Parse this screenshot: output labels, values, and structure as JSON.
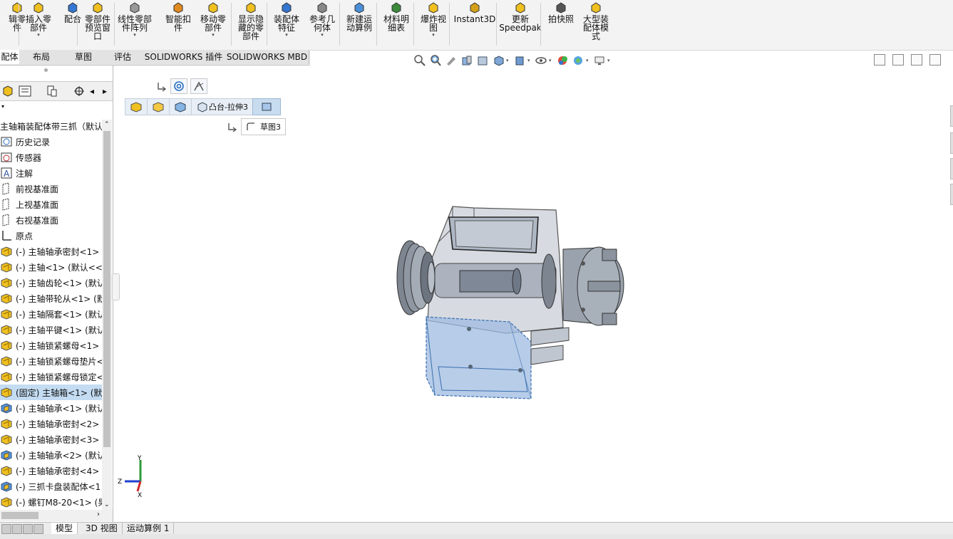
{
  "ribbon": {
    "buttons": [
      {
        "id": "edit-component",
        "label": "辑零\n件",
        "dd": false
      },
      {
        "id": "insert-components",
        "label": "插入零\n部件",
        "dd": true
      },
      {
        "id": "mate",
        "label": "配合",
        "dd": false
      },
      {
        "id": "component-preview",
        "label": "零部件\n预览窗\n口",
        "dd": false
      },
      {
        "id": "linear-pattern",
        "label": "线性零部\n件阵列",
        "dd": true
      },
      {
        "id": "smart-fasteners",
        "label": "智能扣\n件",
        "dd": false
      },
      {
        "id": "move-component",
        "label": "移动零\n部件",
        "dd": true
      },
      {
        "id": "show-hidden",
        "label": "显示隐\n藏的零\n部件",
        "dd": false
      },
      {
        "id": "assembly-features",
        "label": "装配体\n特征",
        "dd": true
      },
      {
        "id": "reference-geometry",
        "label": "参考几\n何体",
        "dd": true
      },
      {
        "id": "new-motion-study",
        "label": "新建运\n动算例",
        "dd": false
      },
      {
        "id": "bom",
        "label": "材料明\n细表",
        "dd": false
      },
      {
        "id": "exploded-view",
        "label": "爆炸视\n图",
        "dd": true
      },
      {
        "id": "instant3d",
        "label": "Instant3D",
        "dd": false
      },
      {
        "id": "update-speedpak",
        "label": "更新\nSpeedpak",
        "dd": false
      },
      {
        "id": "snapshot",
        "label": "拍快照",
        "dd": false
      },
      {
        "id": "large-assembly",
        "label": "大型装\n配体模\n式",
        "dd": false
      }
    ]
  },
  "tabs": [
    {
      "label": "配体",
      "active": true
    },
    {
      "label": "布局",
      "active": false
    },
    {
      "label": "草图",
      "active": false
    },
    {
      "label": "评估",
      "active": false
    },
    {
      "label": "SOLIDWORKS 插件",
      "active": false
    },
    {
      "label": "SOLIDWORKS MBD",
      "active": false
    }
  ],
  "tree": {
    "root": "主轴箱装配体带三抓（默认",
    "items": [
      {
        "label": "历史记录",
        "icon": "history-icon"
      },
      {
        "label": "传感器",
        "icon": "sensor-icon"
      },
      {
        "label": "注解",
        "icon": "annotation-icon"
      },
      {
        "label": "前视基准面",
        "icon": "plane-icon"
      },
      {
        "label": "上视基准面",
        "icon": "plane-icon"
      },
      {
        "label": "右视基准面",
        "icon": "plane-icon"
      },
      {
        "label": "原点",
        "icon": "origin-icon"
      },
      {
        "label": "(-) 主轴轴承密封<1>",
        "icon": "part-icon"
      },
      {
        "label": "(-) 主轴<1> (默认<<默",
        "icon": "part-icon"
      },
      {
        "label": "(-) 主轴齿轮<1> (默认",
        "icon": "part-icon"
      },
      {
        "label": "(-) 主轴带轮从<1> (默",
        "icon": "part-icon"
      },
      {
        "label": "(-) 主轴隔套<1> (默认",
        "icon": "part-icon"
      },
      {
        "label": "(-) 主轴平键<1> (默认",
        "icon": "part-icon"
      },
      {
        "label": "(-) 主轴锁紧螺母<1>",
        "icon": "part-icon"
      },
      {
        "label": "(-) 主轴锁紧螺母垫片<",
        "icon": "part-icon"
      },
      {
        "label": "(-) 主轴锁紧螺母锁定<",
        "icon": "part-icon"
      },
      {
        "label": "(固定) 主轴箱<1> (默认",
        "icon": "part-icon",
        "selected": true
      },
      {
        "label": "(-) 主轴轴承<1> (默认",
        "icon": "subassembly-icon"
      },
      {
        "label": "(-) 主轴轴承密封<2>",
        "icon": "part-icon"
      },
      {
        "label": "(-) 主轴轴承密封<3>",
        "icon": "part-icon"
      },
      {
        "label": "(-) 主轴轴承<2> (默认",
        "icon": "subassembly-icon"
      },
      {
        "label": "(-) 主轴轴承密封<4>",
        "icon": "part-icon"
      },
      {
        "label": "(-) 三抓卡盘装配体<1",
        "icon": "subassembly-icon"
      },
      {
        "label": "(-) 螺钉M8-20<1> (果",
        "icon": "part-icon"
      }
    ]
  },
  "breadcrumb": {
    "feature": "凸台-拉伸3",
    "sketch": "草图3"
  },
  "bottom_tabs": [
    {
      "label": "模型",
      "active": true
    },
    {
      "label": "3D 视图",
      "active": false
    },
    {
      "label": "运动算例 1",
      "active": false
    }
  ],
  "triad": {
    "x": "X",
    "y": "Y",
    "z": "Z"
  },
  "colors": {
    "accent": "#1f6fd1",
    "selection": "#c4dcf2",
    "part_yellow": "#f0c020",
    "housing_blue": "#9fbbe0"
  }
}
